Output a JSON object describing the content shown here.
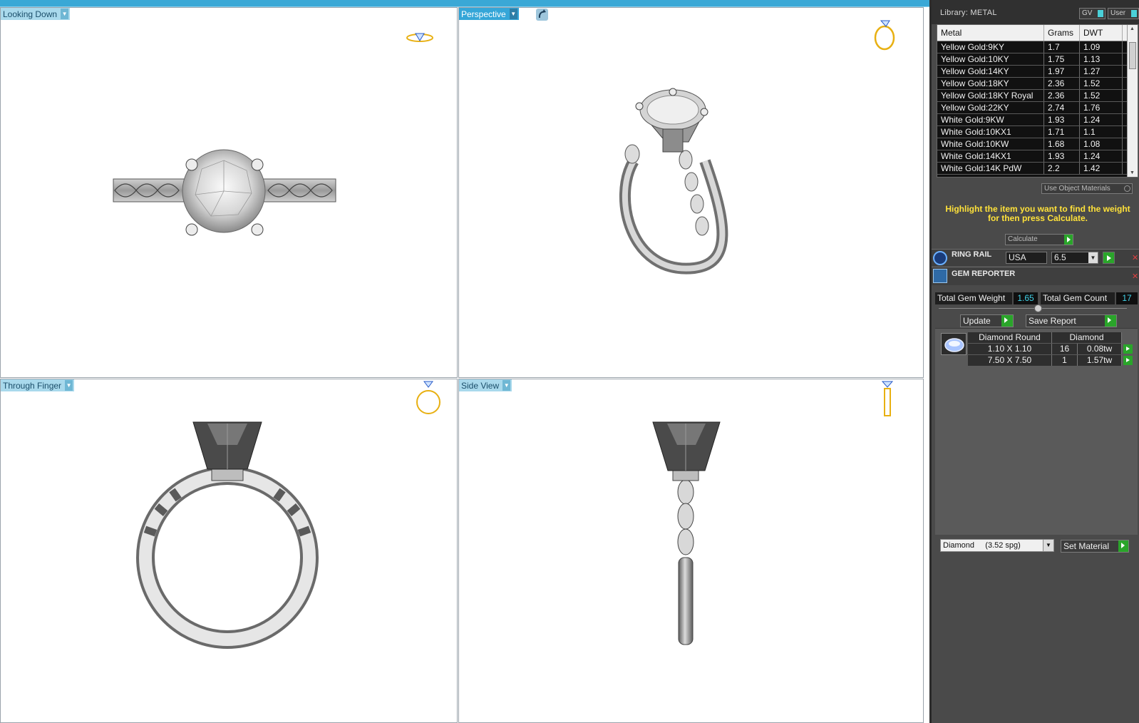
{
  "viewports": {
    "top_left": {
      "label": "Looking Down"
    },
    "top_right": {
      "label": "Perspective"
    },
    "bottom_left": {
      "label": "Through Finger"
    },
    "bottom_right": {
      "label": "Side View"
    }
  },
  "library": {
    "title": "Library: METAL",
    "gv_label": "GV",
    "user_label": "User",
    "columns": {
      "metal": "Metal",
      "grams": "Grams",
      "dwt": "DWT"
    },
    "rows": [
      {
        "metal": "Yellow Gold:9KY",
        "grams": "1.7",
        "dwt": "1.09"
      },
      {
        "metal": "Yellow Gold:10KY",
        "grams": "1.75",
        "dwt": "1.13"
      },
      {
        "metal": "Yellow Gold:14KY",
        "grams": "1.97",
        "dwt": "1.27"
      },
      {
        "metal": "Yellow Gold:18KY",
        "grams": "2.36",
        "dwt": "1.52"
      },
      {
        "metal": "Yellow Gold:18KY Royal",
        "grams": "2.36",
        "dwt": "1.52"
      },
      {
        "metal": "Yellow Gold:22KY",
        "grams": "2.74",
        "dwt": "1.76"
      },
      {
        "metal": "White Gold:9KW",
        "grams": "1.93",
        "dwt": "1.24"
      },
      {
        "metal": "White Gold:10KX1",
        "grams": "1.71",
        "dwt": "1.1"
      },
      {
        "metal": "White Gold:10KW",
        "grams": "1.68",
        "dwt": "1.08"
      },
      {
        "metal": "White Gold:14KX1",
        "grams": "1.93",
        "dwt": "1.24"
      },
      {
        "metal": "White Gold:14K PdW",
        "grams": "2.2",
        "dwt": "1.42"
      }
    ],
    "use_object_materials": "Use Object Materials",
    "hint": "Highlight the item you want to find the weight for then press Calculate.",
    "calculate": "Calculate"
  },
  "ring_rail": {
    "title": "RING RAIL",
    "standard": "USA",
    "size": "6.5"
  },
  "gem_reporter": {
    "title": "GEM REPORTER",
    "total_weight_label": "Total Gem Weight",
    "total_weight": "1.65",
    "total_count_label": "Total Gem Count",
    "total_count": "17",
    "update": "Update",
    "save_report": "Save Report",
    "group_name": "Diamond Round",
    "group_material": "Diamond",
    "gems": [
      {
        "size": "1.10 X 1.10",
        "count": "16",
        "tw": "0.08tw"
      },
      {
        "size": "7.50 X 7.50",
        "count": "1",
        "tw": "1.57tw"
      }
    ],
    "material_select": "Diamond     (3.52 spg)",
    "set_material": "Set Material"
  }
}
